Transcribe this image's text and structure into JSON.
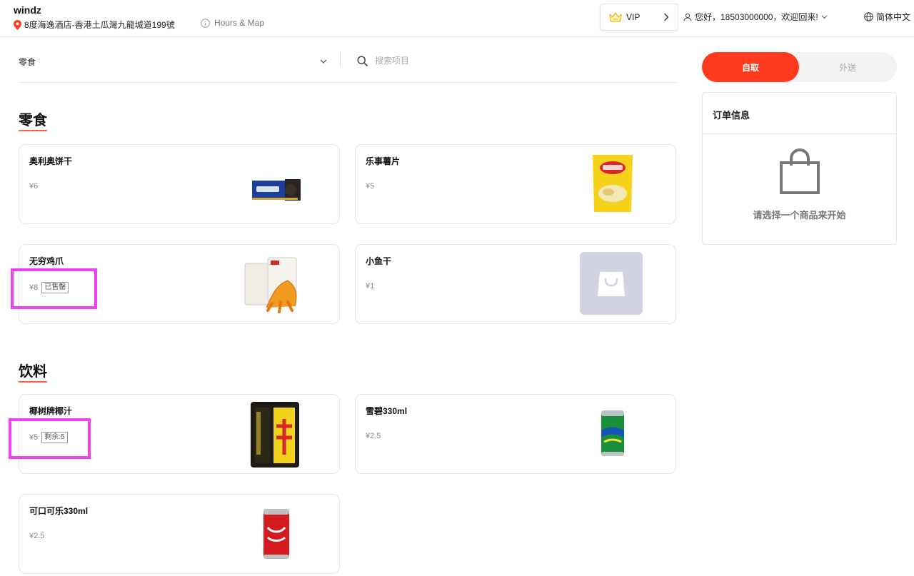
{
  "header": {
    "store_name": "windz",
    "store_address": "8度海逸酒店-香港土瓜灣九龍城道199號",
    "hours_link": "Hours & Map",
    "vip_label": "VIP",
    "greeting": "您好，18503000000，欢迎回来!",
    "language": "简体中文"
  },
  "filter": {
    "selected_category": "零食",
    "search_placeholder": "搜索项目"
  },
  "sections": [
    {
      "title": "零食",
      "items": [
        {
          "name": "奥利奥饼干",
          "price": "¥6",
          "tag": "",
          "image": "oreo-biscuit-box"
        },
        {
          "name": "乐事薯片",
          "price": "¥5",
          "tag": "",
          "image": "lays-chips-bag"
        },
        {
          "name": "无穷鸡爪",
          "price": "¥8",
          "tag": "已售罄",
          "image": "chicken-feet-pack"
        },
        {
          "name": "小鱼干",
          "price": "¥1",
          "tag": "",
          "image": "placeholder-bag-icon"
        }
      ]
    },
    {
      "title": "饮料",
      "items": [
        {
          "name": "椰树牌椰汁",
          "price": "¥5",
          "tag": "剩余:5",
          "image": "coconut-juice-can"
        },
        {
          "name": "雪碧330ml",
          "price": "¥2.5",
          "tag": "",
          "image": "sprite-can"
        },
        {
          "name": "可口可乐330ml",
          "price": "¥2.5",
          "tag": "",
          "image": "coke-can"
        }
      ]
    }
  ],
  "order": {
    "mode_pickup": "自取",
    "mode_delivery": "外送",
    "active_mode": "pickup",
    "title": "订单信息",
    "empty_text": "请选择一个商品来开始"
  },
  "colors": {
    "accent": "#ff3b1f",
    "highlight": "#f23ff0"
  }
}
